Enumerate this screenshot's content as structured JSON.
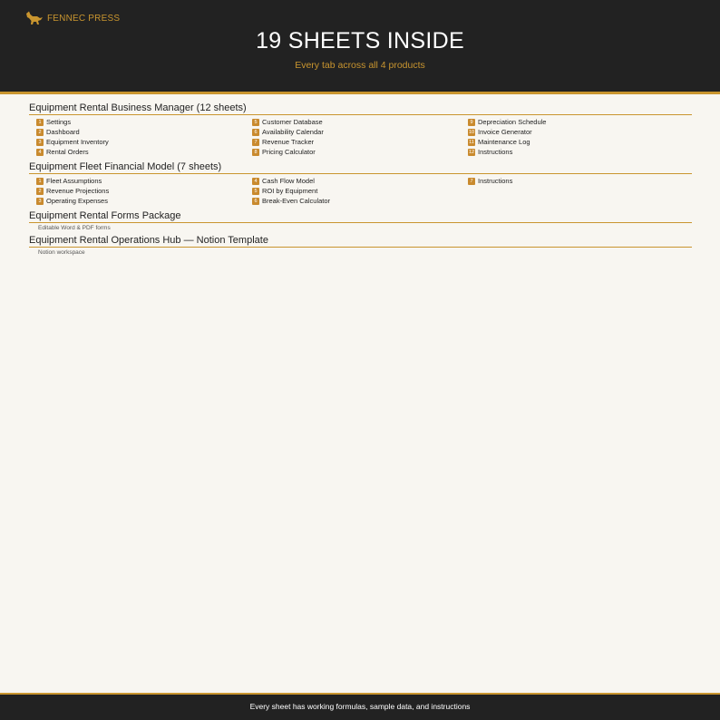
{
  "header": {
    "brand": "FENNEC PRESS",
    "title": "19 SHEETS INSIDE",
    "subtitle": "Every tab across all 4 products"
  },
  "colors": {
    "accent": "#c9952f",
    "dark": "#222222",
    "background": "#f8f6f1"
  },
  "icons": {
    "brand": "fox-icon"
  },
  "products": [
    {
      "title": "Equipment Rental Business Manager (12 sheets)",
      "sheets": [
        {
          "num": "1",
          "name": "Settings"
        },
        {
          "num": "2",
          "name": "Dashboard"
        },
        {
          "num": "3",
          "name": "Equipment Inventory"
        },
        {
          "num": "4",
          "name": "Rental Orders"
        },
        {
          "num": "5",
          "name": "Customer Database"
        },
        {
          "num": "6",
          "name": "Availability Calendar"
        },
        {
          "num": "7",
          "name": "Revenue Tracker"
        },
        {
          "num": "8",
          "name": "Pricing Calculator"
        },
        {
          "num": "9",
          "name": "Depreciation Schedule"
        },
        {
          "num": "10",
          "name": "Invoice Generator"
        },
        {
          "num": "11",
          "name": "Maintenance Log"
        },
        {
          "num": "12",
          "name": "Instructions"
        }
      ]
    },
    {
      "title": "Equipment Fleet Financial Model (7 sheets)",
      "sheets": [
        {
          "num": "1",
          "name": "Fleet Assumptions"
        },
        {
          "num": "2",
          "name": "Revenue Projections"
        },
        {
          "num": "3",
          "name": "Operating Expenses"
        },
        {
          "num": "4",
          "name": "Cash Flow Model"
        },
        {
          "num": "5",
          "name": "ROI by Equipment"
        },
        {
          "num": "6",
          "name": "Break-Even Calculator"
        },
        {
          "num": "7",
          "name": "Instructions"
        }
      ]
    },
    {
      "title": "Equipment Rental Forms Package",
      "subtitle": "Editable Word & PDF forms"
    },
    {
      "title": "Equipment Rental Operations Hub — Notion Template",
      "subtitle": "Notion workspace"
    }
  ],
  "footer": {
    "text": "Every sheet has working formulas, sample data, and instructions"
  }
}
